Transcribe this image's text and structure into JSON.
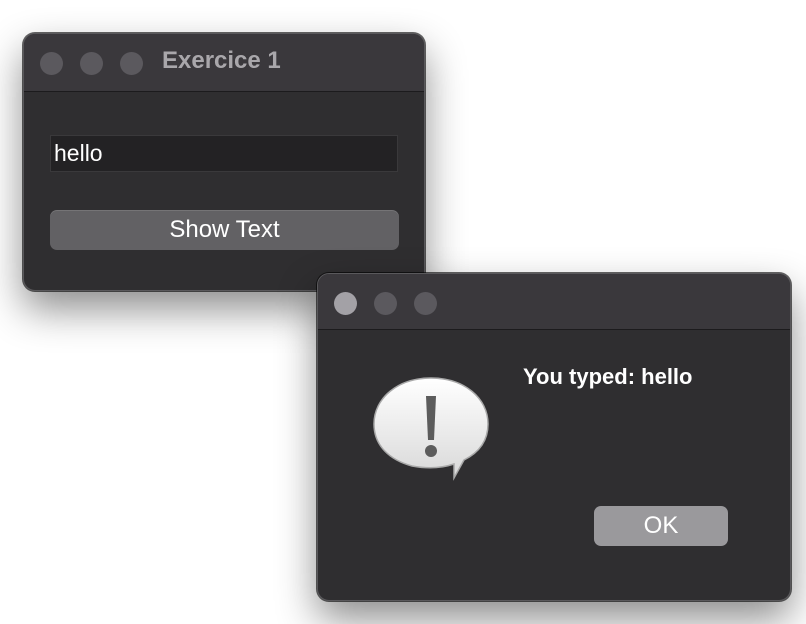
{
  "main_window": {
    "title": "Exercice 1",
    "input_value": "hello",
    "button_label": "Show Text"
  },
  "dialog": {
    "message": "You typed: hello",
    "ok_label": "OK",
    "icon": "alert-speech-bubble-icon"
  },
  "colors": {
    "window_bg": "#2f2e30",
    "titlebar_bg": "#3a383c",
    "button_bg": "#626164",
    "ok_button_bg": "#9a999c"
  }
}
